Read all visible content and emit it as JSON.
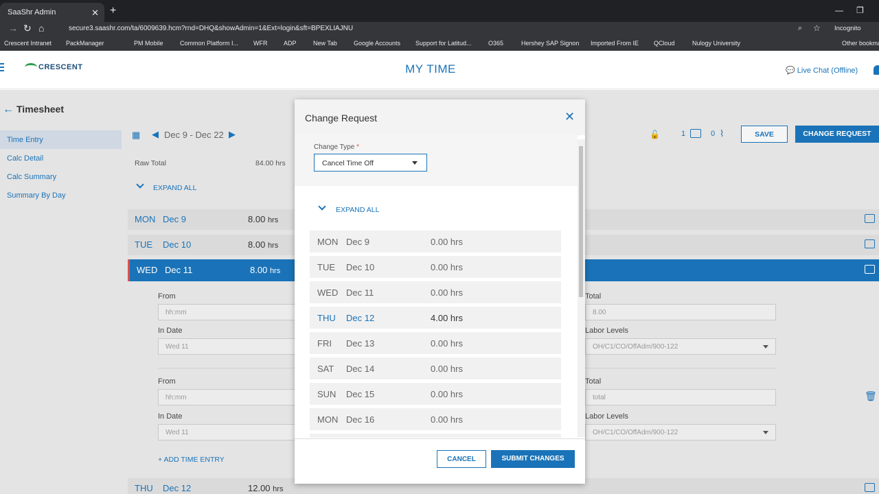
{
  "browser": {
    "tab_title": "SaaShr Admin",
    "url": "secure3.saashr.com/ta/6009639.hcm?rnd=DHQ&showAdmin=1&Ext=login&sft=BPEXLIAJNU",
    "mode": "Incognito",
    "bookmarks": [
      "Crescent Intranet",
      "PackManager",
      "PM Mobile",
      "Common Platform I...",
      "WFR",
      "ADP",
      "New Tab",
      "Google Accounts",
      "Support for Latitud...",
      "O365",
      "Hershey SAP Signon",
      "Imported From IE",
      "QCloud",
      "Nulogy University",
      "Other bookma"
    ]
  },
  "header": {
    "logo": "CRESCENT",
    "title": "MY TIME",
    "live_chat": "Live Chat (Offline)"
  },
  "page": {
    "title": "Timesheet",
    "nav": [
      "Time Entry",
      "Calc Detail",
      "Calc Summary",
      "Summary By Day"
    ],
    "date_range": "Dec 9 - Dec 22",
    "raw_total_label": "Raw Total",
    "raw_total_value": "84.00 hrs",
    "expand_all": "EXPAND ALL",
    "comments_count": "1",
    "attachments_count": "0",
    "save": "SAVE",
    "change_request": "CHANGE REQUEST",
    "days": [
      {
        "name": "MON",
        "date": "Dec 9",
        "hours": "8.00",
        "unit": "hrs"
      },
      {
        "name": "TUE",
        "date": "Dec 10",
        "hours": "8.00",
        "unit": "hrs"
      },
      {
        "name": "WED",
        "date": "Dec 11",
        "hours": "8.00",
        "unit": "hrs"
      },
      {
        "name": "THU",
        "date": "Dec 12",
        "hours": "12.00",
        "unit": "hrs"
      }
    ],
    "entry": {
      "from_label": "From",
      "from_placeholder": "hh:mm",
      "in_date_label": "In Date",
      "in_date_value": "Wed 11",
      "total_label": "Total",
      "total_value_1": "8.00",
      "total_placeholder_2": "total",
      "labor_label": "Labor Levels",
      "labor_value": "OH/C1/CO/OffAdm/900-122",
      "add_entry": "ADD TIME ENTRY"
    }
  },
  "modal": {
    "title": "Change Request",
    "change_type_label": "Change Type",
    "required_mark": "*",
    "change_type_value": "Cancel Time Off",
    "expand_all": "EXPAND ALL",
    "rows": [
      {
        "day": "MON",
        "date": "Dec 9",
        "hours": "0.00 hrs"
      },
      {
        "day": "TUE",
        "date": "Dec 10",
        "hours": "0.00 hrs"
      },
      {
        "day": "WED",
        "date": "Dec 11",
        "hours": "0.00 hrs"
      },
      {
        "day": "THU",
        "date": "Dec 12",
        "hours": "4.00 hrs"
      },
      {
        "day": "FRI",
        "date": "Dec 13",
        "hours": "0.00 hrs"
      },
      {
        "day": "SAT",
        "date": "Dec 14",
        "hours": "0.00 hrs"
      },
      {
        "day": "SUN",
        "date": "Dec 15",
        "hours": "0.00 hrs"
      },
      {
        "day": "MON",
        "date": "Dec 16",
        "hours": "0.00 hrs"
      }
    ],
    "cancel": "CANCEL",
    "submit": "SUBMIT CHANGES"
  }
}
